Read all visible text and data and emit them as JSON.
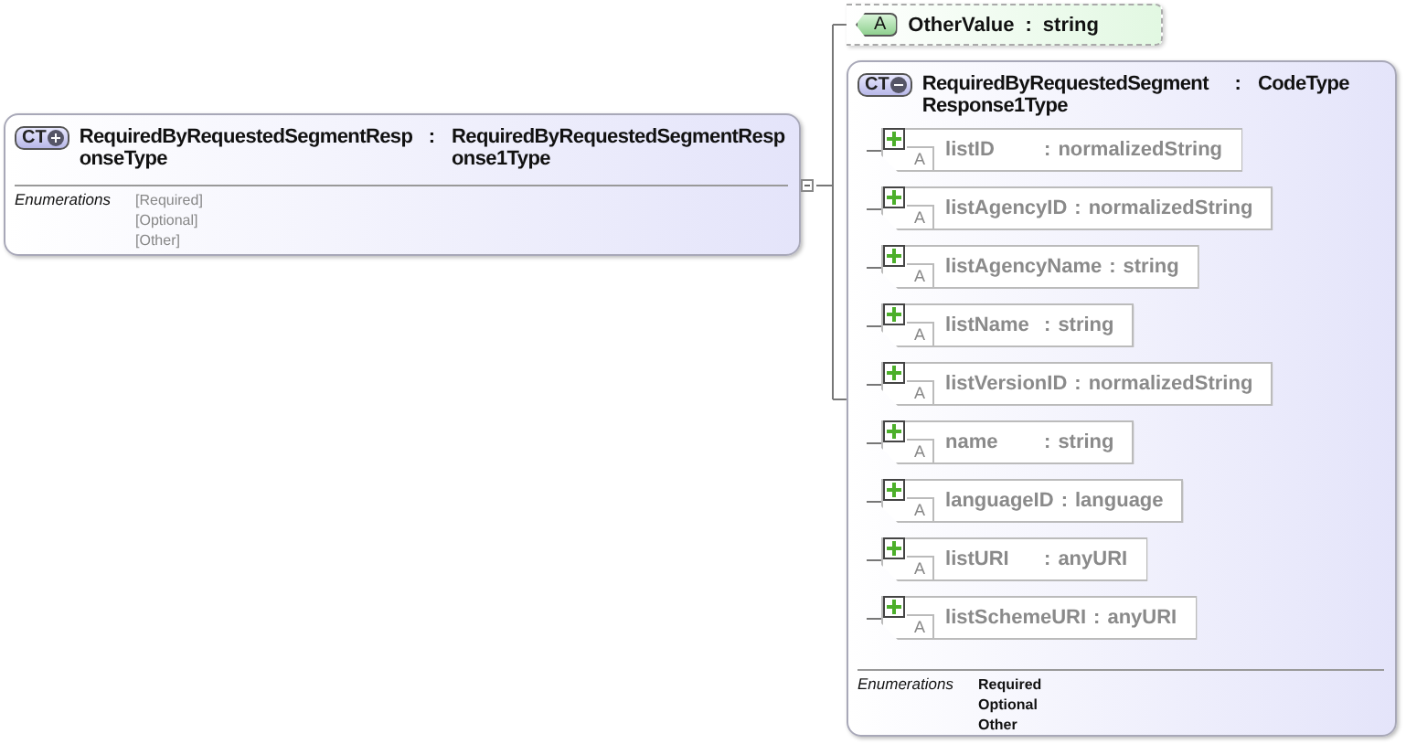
{
  "element": {
    "badge": "CT",
    "expanded": false,
    "name": "RequiredByRequestedSegmentResponseType",
    "separator": ":",
    "type": "RequiredByRequestedSegmentResponse1Type",
    "collapsible": true,
    "enumerations_label": "Enumerations",
    "enumerations": [
      "[Required]",
      "[Optional]",
      "[Other]"
    ]
  },
  "attribute": {
    "badge": "A",
    "name": "OtherValue",
    "separator": ":",
    "type": "string",
    "optional": true
  },
  "complex_type": {
    "badge": "CT",
    "expanded": true,
    "name": "RequiredByRequestedSegmentResponse1Type",
    "separator": ":",
    "type": "CodeType",
    "enumerations_label": "Enumerations",
    "enumerations": [
      "Required",
      "Optional",
      "Other"
    ],
    "attributes": [
      {
        "badge": "A",
        "name": "listID",
        "separator": ":",
        "type": "normalizedString",
        "expanded": false
      },
      {
        "badge": "A",
        "name": "listAgencyID",
        "separator": ":",
        "type": "normalizedString",
        "expanded": false
      },
      {
        "badge": "A",
        "name": "listAgencyName",
        "separator": ":",
        "type": "string",
        "expanded": false
      },
      {
        "badge": "A",
        "name": "listName",
        "separator": ":",
        "type": "string",
        "expanded": false
      },
      {
        "badge": "A",
        "name": "listVersionID",
        "separator": ":",
        "type": "normalizedString",
        "expanded": false
      },
      {
        "badge": "A",
        "name": "name",
        "separator": ":",
        "type": "string",
        "expanded": false
      },
      {
        "badge": "A",
        "name": "languageID",
        "separator": ":",
        "type": "language",
        "expanded": false
      },
      {
        "badge": "A",
        "name": "listURI",
        "separator": ":",
        "type": "anyURI",
        "expanded": false
      },
      {
        "badge": "A",
        "name": "listSchemeURI",
        "separator": ":",
        "type": "anyURI",
        "expanded": false
      }
    ]
  }
}
